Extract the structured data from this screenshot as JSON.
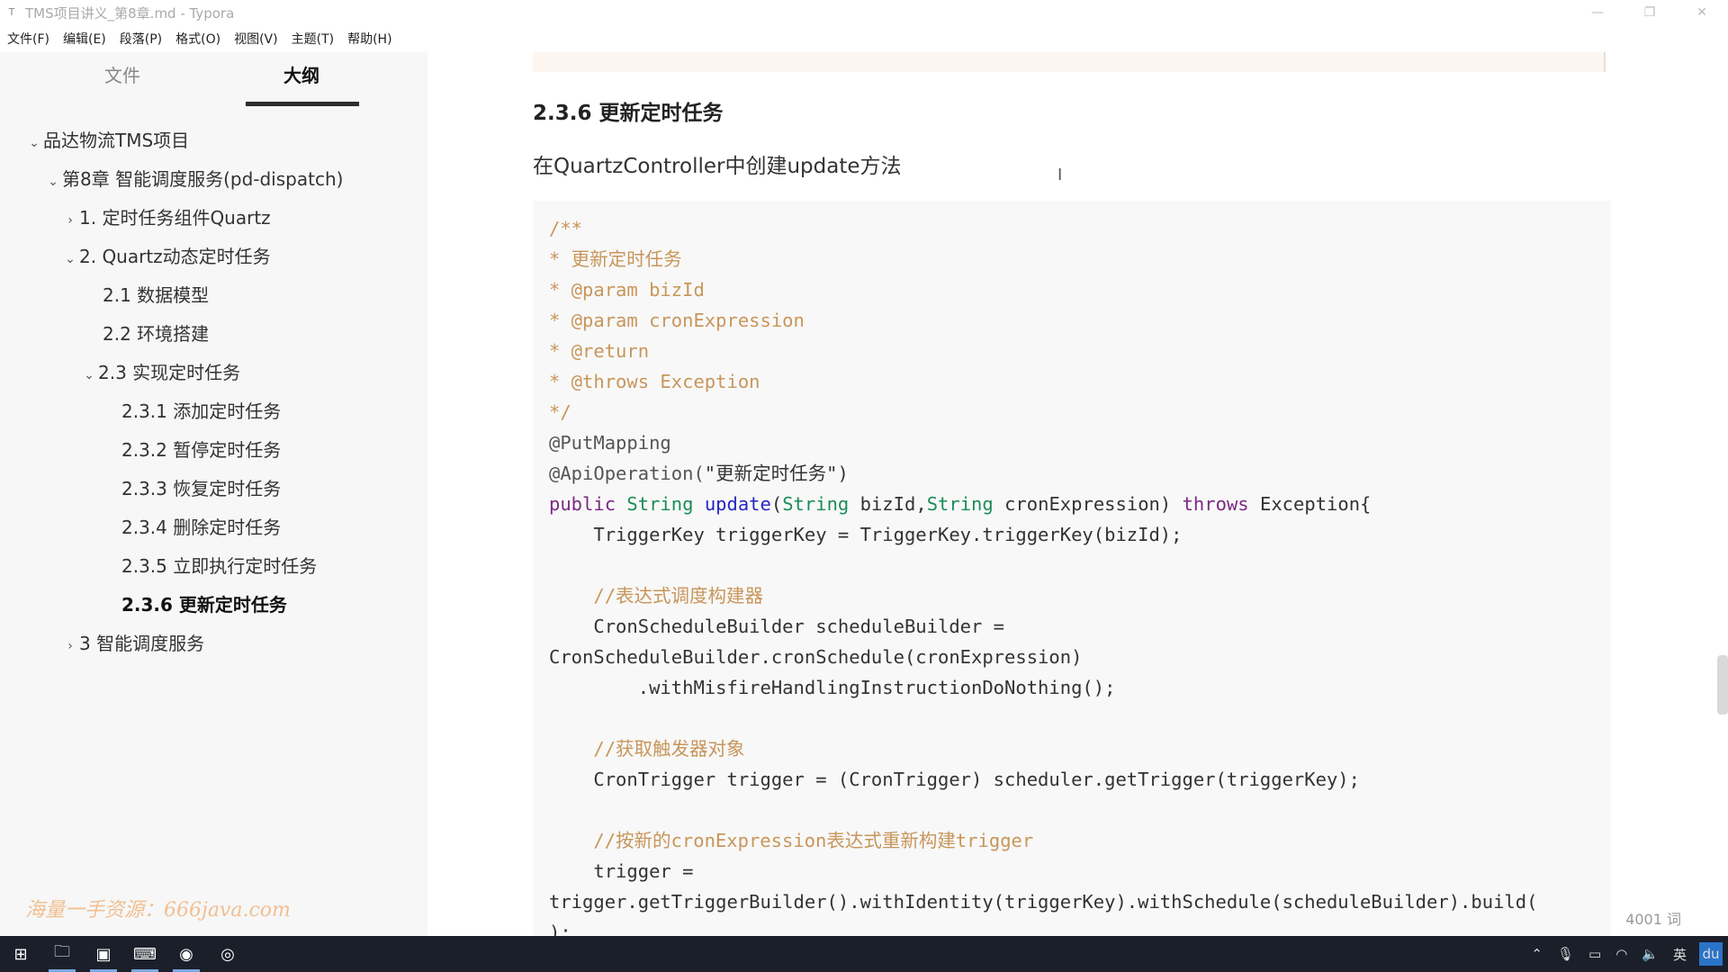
{
  "window": {
    "title": "TMS项目讲义_第8章.md - Typora",
    "app_icon": "T",
    "minimize": "—",
    "maximize": "❐",
    "close": "✕"
  },
  "menu": [
    "文件(F)",
    "编辑(E)",
    "段落(P)",
    "格式(O)",
    "视图(V)",
    "主题(T)",
    "帮助(H)"
  ],
  "sidebar": {
    "tabs": {
      "files": "文件",
      "outline": "大纲"
    },
    "outline": [
      {
        "label": "品达物流TMS项目",
        "chevron": "⌄"
      },
      {
        "label": "第8章 智能调度服务(pd-dispatch)",
        "chevron": "⌄"
      },
      {
        "label": "1. 定时任务组件Quartz",
        "chevron": "›"
      },
      {
        "label": "2. Quartz动态定时任务",
        "chevron": "⌄"
      },
      {
        "label": "2.1 数据模型",
        "chevron": ""
      },
      {
        "label": "2.2 环境搭建",
        "chevron": ""
      },
      {
        "label": "2.3 实现定时任务",
        "chevron": "⌄"
      },
      {
        "label": "2.3.1 添加定时任务",
        "chevron": ""
      },
      {
        "label": "2.3.2 暂停定时任务",
        "chevron": ""
      },
      {
        "label": "2.3.3 恢复定时任务",
        "chevron": ""
      },
      {
        "label": "2.3.4 删除定时任务",
        "chevron": ""
      },
      {
        "label": "2.3.5 立即执行定时任务",
        "chevron": ""
      },
      {
        "label": "2.3.6 更新定时任务",
        "chevron": "",
        "active": true
      },
      {
        "label": "3 智能调度服务",
        "chevron": "›"
      }
    ],
    "watermark": "海量一手资源：666java.com",
    "collapse_icon": "‹",
    "source_icon": "</>"
  },
  "document": {
    "heading": "2.3.6 更新定时任务",
    "paragraph": "在QuartzController中创建update方法",
    "cursor": "I",
    "code": {
      "c1": "/**",
      "c2": "* 更新定时任务",
      "c3": "* @param bizId",
      "c4": "* @param cronExpression",
      "c5": "* @return",
      "c6": "* @throws Exception",
      "c7": "*/",
      "ann1": "@PutMapping",
      "ann2": "@ApiOperation(",
      "ann2_str": "\"更新定时任务\"",
      "ann2_end": ")",
      "sig_public": "public",
      "sig_type1": "String",
      "sig_fn": "update",
      "sig_open": "(",
      "sig_type2": "String",
      "sig_p1": " bizId,",
      "sig_type3": "String",
      "sig_p2": " cronExpression) ",
      "sig_throws": "throws",
      "sig_end": " Exception{",
      "l1": "    TriggerKey triggerKey = TriggerKey.triggerKey(bizId);",
      "cm1": "    //表达式调度构建器",
      "l2": "    CronScheduleBuilder scheduleBuilder =",
      "l3": "CronScheduleBuilder.cronSchedule(cronExpression)",
      "l4": "        .withMisfireHandlingInstructionDoNothing();",
      "cm2": "    //获取触发器对象",
      "l5": "    CronTrigger trigger = (CronTrigger) scheduler.getTrigger(triggerKey);",
      "cm3": "    //按新的cronExpression表达式重新构建trigger",
      "l6": "    trigger =",
      "l7": "trigger.getTriggerBuilder().withIdentity(triggerKey).withSchedule(scheduleBuilder).build(",
      "l8": ");"
    },
    "word_count": "4001 词"
  },
  "taskbar": {
    "start_icon": "⊞",
    "apps": [
      "🗀",
      "▣",
      "⌨",
      "◉",
      "◎"
    ],
    "tray": [
      "⌃",
      "🎙",
      "▭",
      "◠",
      "🔈",
      "英",
      "du"
    ]
  }
}
